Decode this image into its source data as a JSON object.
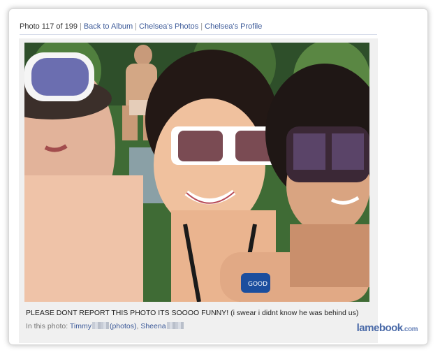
{
  "nav": {
    "photo_counter": "Photo 117 of 199",
    "links": [
      {
        "label": "Back to Album"
      },
      {
        "label": "Chelsea's Photos"
      },
      {
        "label": "Chelsea's Profile"
      }
    ]
  },
  "photo": {
    "wristband_text": "GOOD"
  },
  "caption": "PLEASE DONT REPORT THIS PHOTO ITS SOOOO FUNNY! (i swear i didnt know he was behind us)",
  "tags": {
    "prefix": "In this photo:",
    "people": [
      {
        "name": "Timmy",
        "extra": "(photos)"
      },
      {
        "name": "Sheena"
      }
    ]
  },
  "watermark": {
    "brand": "lamebook",
    "suffix": ".com"
  },
  "colors": {
    "link": "#3b5998",
    "border": "#d8d8d8",
    "watermark": "#4a6aa8"
  }
}
